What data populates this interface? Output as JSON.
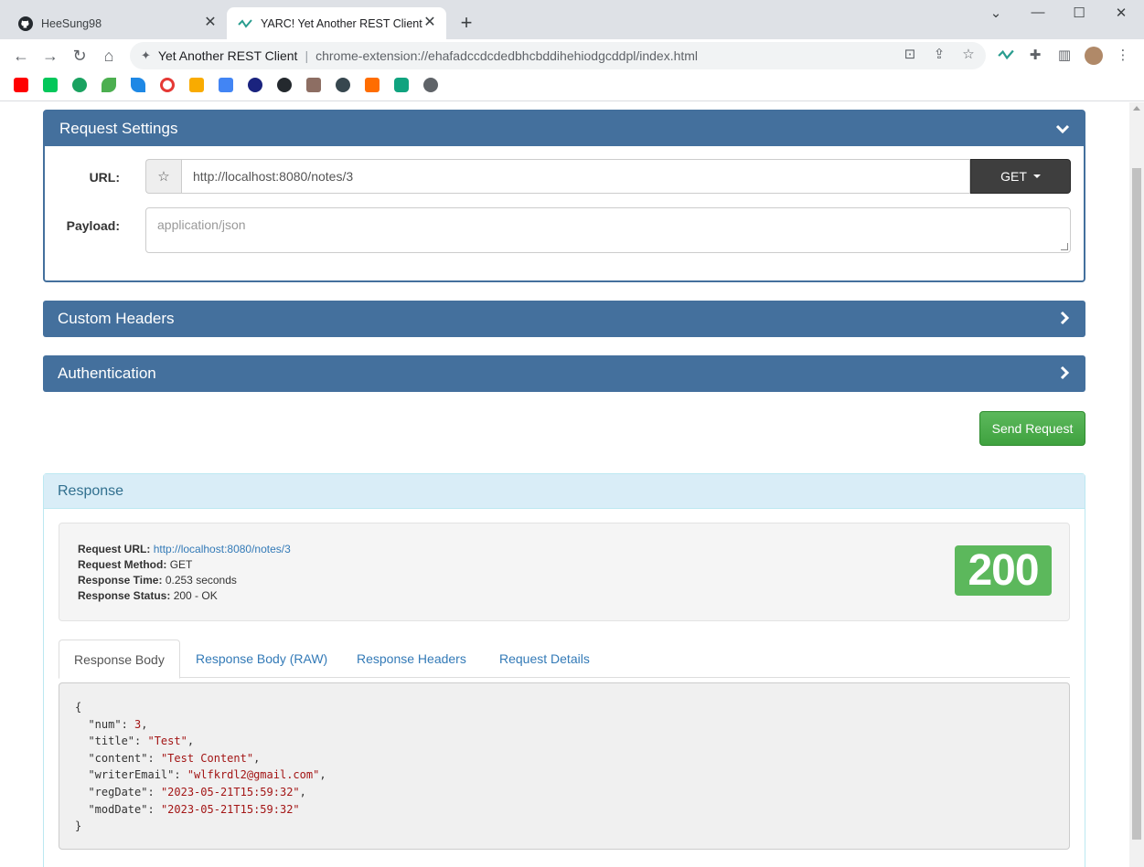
{
  "browser": {
    "tabs": [
      {
        "title": "HeeSung98",
        "favicon": "github-icon",
        "active": false
      },
      {
        "title": "YARC! Yet Another REST Client",
        "favicon": "yarc-icon",
        "active": true
      }
    ],
    "omnibox": {
      "site": "Yet Another REST Client",
      "separator": "|",
      "url": "chrome-extension://ehafadccdcdedbhcbddihehiodgcddpl/index.html"
    },
    "bookmark_icons": [
      "youtube-icon",
      "naver-icon",
      "app-icon",
      "leaf-icon",
      "feather-icon",
      "circle-icon",
      "classroom-icon",
      "drive-icon",
      "owl-icon",
      "github-icon",
      "photo-icon",
      "avatar-icon",
      "box-icon",
      "chatgpt-icon",
      "globe-icon"
    ]
  },
  "request_settings": {
    "title": "Request Settings",
    "url_label": "URL:",
    "url_value": "http://localhost:8080/notes/3",
    "method": "GET",
    "payload_label": "Payload:",
    "payload_placeholder": "application/json"
  },
  "custom_headers": {
    "title": "Custom Headers"
  },
  "authentication": {
    "title": "Authentication"
  },
  "send_button": "Send Request",
  "response": {
    "title": "Response",
    "request_url_label": "Request URL:",
    "request_url": "http://localhost:8080/notes/3",
    "request_method_label": "Request Method:",
    "request_method": "GET",
    "response_time_label": "Response Time:",
    "response_time": "0.253 seconds",
    "response_status_label": "Response Status:",
    "response_status": "200 - OK",
    "status_code": "200",
    "tabs": [
      "Response Body",
      "Response Body (RAW)",
      "Response Headers",
      "Request Details"
    ],
    "body": {
      "open": "{",
      "close": "}",
      "fields": [
        {
          "key": "\"num\"",
          "value": "3",
          "comma": ","
        },
        {
          "key": "\"title\"",
          "value": "\"Test\"",
          "comma": ","
        },
        {
          "key": "\"content\"",
          "value": "\"Test Content\"",
          "comma": ","
        },
        {
          "key": "\"writerEmail\"",
          "value": "\"wlfkrdl2@gmail.com\"",
          "comma": ","
        },
        {
          "key": "\"regDate\"",
          "value": "\"2023-05-21T15:59:32\"",
          "comma": ","
        },
        {
          "key": "\"modDate\"",
          "value": "\"2023-05-21T15:59:32\"",
          "comma": ""
        }
      ]
    }
  },
  "colors": {
    "panel_header": "#44709d",
    "send_green": "#5cb85c",
    "status_green": "#5cb85c",
    "response_header": "#d9edf7"
  }
}
